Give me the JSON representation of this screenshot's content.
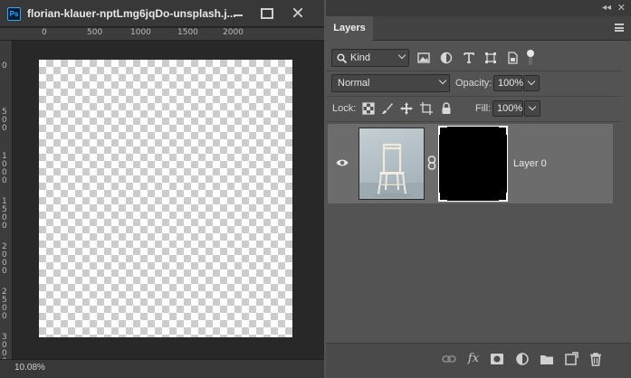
{
  "document": {
    "app_icon": "Ps",
    "title": "florian-klauer-nptLmg6jqDo-unsplash.j...",
    "zoom": "10.08%",
    "ruler_top": [
      "0",
      "500",
      "1000",
      "1500",
      "2000"
    ],
    "ruler_left": [
      "0",
      "500",
      "1000",
      "1500",
      "2000",
      "2500",
      "3000"
    ]
  },
  "panel": {
    "tab": "Layers",
    "filter": {
      "kind_label": "Kind",
      "icons": [
        "image-filter-icon",
        "adjustment-filter-icon",
        "type-filter-icon",
        "shape-filter-icon",
        "smart-object-filter-icon",
        "filter-toggle-icon"
      ]
    },
    "blend_mode": "Normal",
    "opacity_label": "Opacity:",
    "opacity_value": "100%",
    "lock_label": "Lock:",
    "fill_label": "Fill:",
    "fill_value": "100%",
    "layers": [
      {
        "name": "Layer 0",
        "visible": true,
        "has_mask": true
      }
    ],
    "footer_icons": [
      "link-layers-icon",
      "fx-icon",
      "add-mask-icon",
      "adjustment-layer-icon",
      "new-group-icon",
      "new-layer-icon",
      "delete-layer-icon"
    ],
    "fx_text": "fx"
  }
}
